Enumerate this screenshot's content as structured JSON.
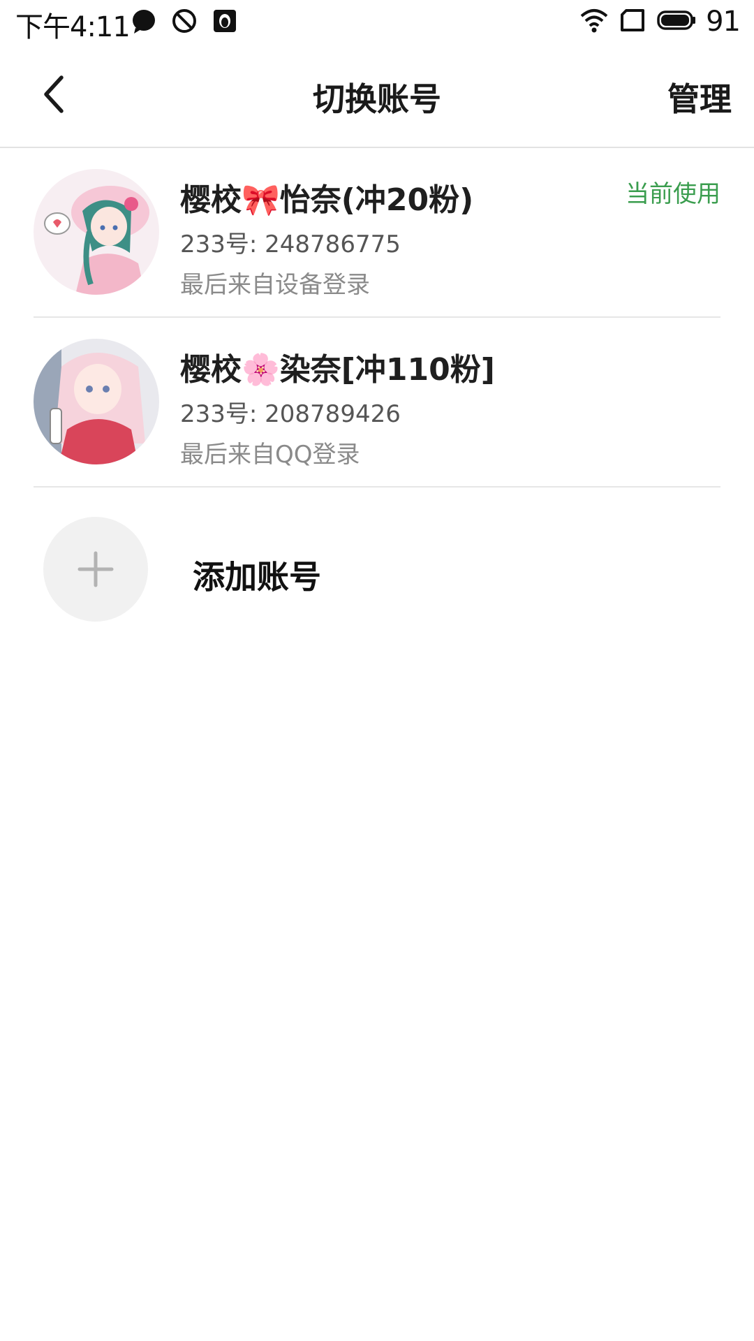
{
  "status_bar": {
    "time": "下午4:11",
    "left_icons": [
      "chat-bubble-icon",
      "do-not-disturb-icon",
      "qq-penguin-icon"
    ],
    "right_icons": [
      "wifi-icon",
      "sim-card-icon",
      "battery-icon"
    ],
    "battery_level": "91"
  },
  "nav": {
    "back_icon": "chevron-left-icon",
    "title": "切换账号",
    "manage_label": "管理"
  },
  "accounts": [
    {
      "name": "樱校🎀怡奈(冲20粉)",
      "id_text": "233号: 248786775",
      "source": "最后来自设备登录",
      "current_label": "当前使用",
      "is_current": true
    },
    {
      "name": "樱校🌸染奈[冲110粉]",
      "id_text": "233号: 208789426",
      "source": "最后来自QQ登录",
      "is_current": false
    }
  ],
  "add_account": {
    "icon": "plus-icon",
    "label": "添加账号"
  },
  "colors": {
    "accent_green": "#3a9d4e",
    "divider": "#e6e6e6",
    "add_circle_bg": "#f1f1f1"
  }
}
